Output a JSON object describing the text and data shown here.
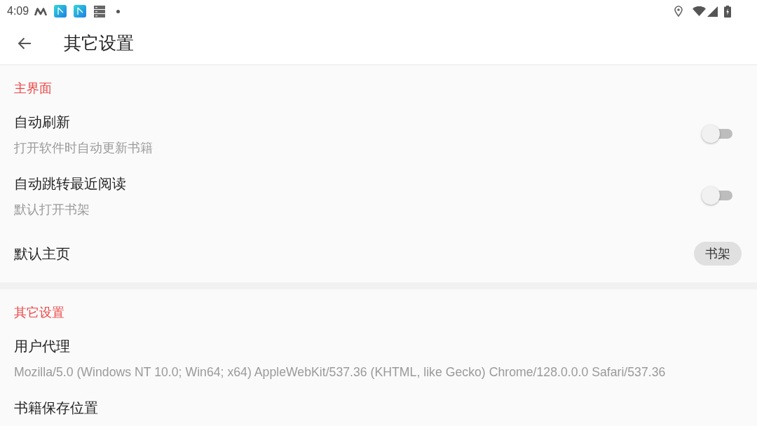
{
  "status_bar": {
    "time": "4:09"
  },
  "app_bar": {
    "title": "其它设置"
  },
  "sections": [
    {
      "title": "主界面",
      "items": [
        {
          "kind": "switch",
          "title": "自动刷新",
          "summary": "打开软件时自动更新书籍",
          "on": false
        },
        {
          "kind": "switch",
          "title": "自动跳转最近阅读",
          "summary": "默认打开书架",
          "on": false
        },
        {
          "kind": "choice",
          "title": "默认主页",
          "value": "书架"
        }
      ]
    },
    {
      "title": "其它设置",
      "items": [
        {
          "kind": "text",
          "title": "用户代理",
          "summary": "Mozilla/5.0 (Windows NT 10.0; Win64; x64) AppleWebKit/537.36 (KHTML, like Gecko) Chrome/128.0.0.0 Safari/537.36"
        },
        {
          "kind": "text",
          "title": "书籍保存位置"
        }
      ]
    }
  ]
}
